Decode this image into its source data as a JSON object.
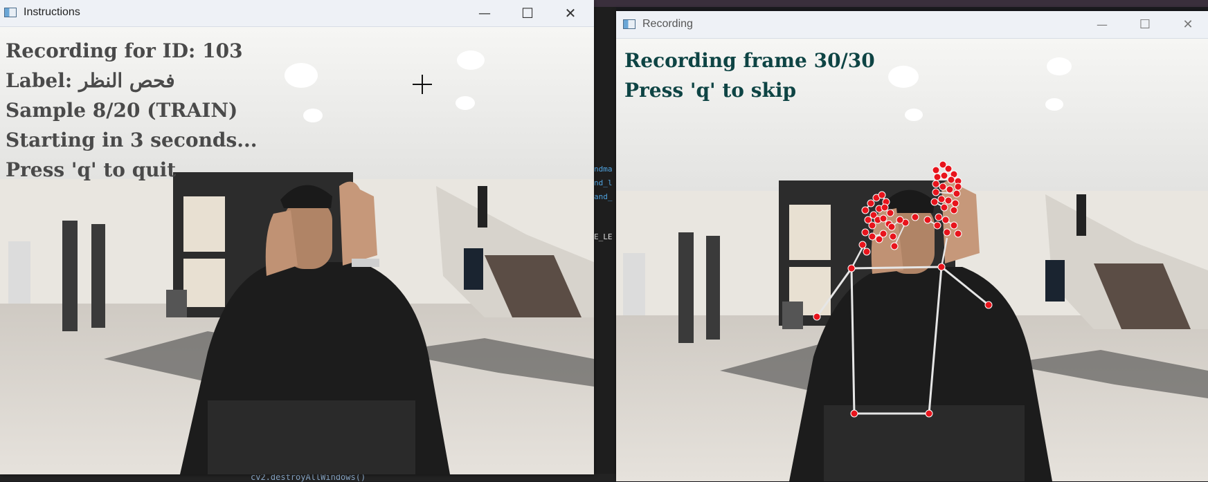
{
  "instructions_window": {
    "title": "Instructions",
    "controls": {
      "minimize": "—",
      "maximize": "☐",
      "close": "✕"
    },
    "overlay_lines": [
      "Recording for ID: 103",
      "Label: فحص النظر",
      "Sample 8/20 (TRAIN)",
      "Starting in 3 seconds...",
      "Press 'q' to quit"
    ]
  },
  "recording_window": {
    "title": "Recording",
    "controls": {
      "minimize": "—",
      "maximize": "☐",
      "close": "✕"
    },
    "overlay_lines": [
      "Recording frame 30/30",
      "Press 'q' to skip"
    ],
    "landmark_color": "#e8141c",
    "connection_color": "#e6e6e6"
  },
  "background_editor": {
    "code_fragments": [
      "ndma",
      "nd_l",
      "and_",
      "E_LE"
    ],
    "bottom_code": "cv2.destroyAllWindows()"
  },
  "colors": {
    "titlebar": "#eef1f6",
    "overlay_text_instructions": "#4a4a4a",
    "overlay_text_recording": "#0e4444"
  }
}
